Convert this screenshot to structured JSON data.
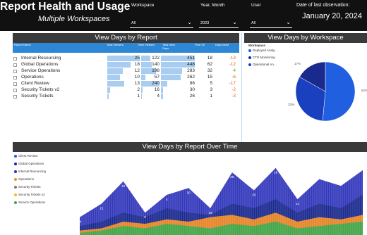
{
  "header": {
    "title": "Report Health and Usage",
    "subtitle": "Multiple Workspaces",
    "filters": [
      {
        "label": "Workspace",
        "value": "All"
      },
      {
        "label": "Year, Month",
        "value": "2023"
      },
      {
        "label": "User",
        "value": "All"
      }
    ],
    "date_label": "Date of last observation:",
    "date_value": "January 20, 2024"
  },
  "report_table": {
    "title": "View Days by Report",
    "columns": [
      "Report Name",
      "Total Viewers",
      "New Viewers",
      "Total View Days",
      "Prior 30",
      "Days MoM"
    ],
    "rows": [
      {
        "name": "Internal Resourcing",
        "total_viewers": "25",
        "new_viewers": "122",
        "total_view_days": "451",
        "prior_30": "18",
        "days_mom": "-13"
      },
      {
        "name": "Global Operations",
        "total_viewers": "18",
        "new_viewers": "140",
        "total_view_days": "448",
        "prior_30": "62",
        "days_mom": "-12"
      },
      {
        "name": "Service Operations",
        "total_viewers": "12",
        "new_viewers": "198",
        "total_view_days": "283",
        "prior_30": "32",
        "days_mom": "4"
      },
      {
        "name": "Operations",
        "total_viewers": "10",
        "new_viewers": "57",
        "total_view_days": "262",
        "prior_30": "15",
        "days_mom": "-6"
      },
      {
        "name": "Client Review",
        "total_viewers": "13",
        "new_viewers": "240",
        "total_view_days": "86",
        "prior_30": "5",
        "days_mom": "-17"
      },
      {
        "name": "Security Tickets v2",
        "total_viewers": "2",
        "new_viewers": "16",
        "total_view_days": "30",
        "prior_30": "3",
        "days_mom": "-2"
      },
      {
        "name": "Security Tickets",
        "total_viewers": "1",
        "new_viewers": "4",
        "total_view_days": "26",
        "prior_30": "1",
        "days_mom": "-3"
      }
    ]
  },
  "workspace_pie": {
    "title": "View Days by Workspace",
    "legend_title": "Workspace",
    "legend": [
      {
        "name": "Deployed Analy...",
        "color": "#1f5fe0"
      },
      {
        "name": "CTO Monitoring",
        "color": "#1a2a8c"
      },
      {
        "name": "Operational An...",
        "color": "#1a3fbf"
      }
    ],
    "slice_labels": [
      "17%",
      "52%",
      "32%"
    ]
  },
  "time_chart": {
    "title": "View Days by Report Over Time",
    "legend": [
      {
        "name": "Client Review",
        "color": "#1f5fe0"
      },
      {
        "name": "Global Operations",
        "color": "#1a2a8c"
      },
      {
        "name": "Internal Resourcing",
        "color": "#2a2fb8"
      },
      {
        "name": "Operations",
        "color": "#f08a24"
      },
      {
        "name": "Security Tickets",
        "color": "#7a7a7a"
      },
      {
        "name": "Security Tickets v2",
        "color": "#e8c020"
      },
      {
        "name": "Service Operations",
        "color": "#3aa64a"
      }
    ],
    "point_labels": [
      "24",
      "21",
      "10",
      "8",
      "4",
      "30",
      "29",
      "28",
      "25",
      "18",
      "14"
    ]
  },
  "chart_data": [
    {
      "type": "pie",
      "title": "View Days by Workspace",
      "categories": [
        "Deployed Analy...",
        "CTO Monitoring",
        "Operational An..."
      ],
      "values": [
        52,
        17,
        32
      ]
    },
    {
      "type": "area",
      "title": "View Days by Report Over Time",
      "series": [
        {
          "name": "Internal Resourcing",
          "values": [
            8,
            14,
            24,
            10,
            18,
            21,
            12,
            28,
            20,
            30,
            16,
            25,
            22,
            29
          ]
        },
        {
          "name": "Global Operations",
          "values": [
            4,
            6,
            10,
            8,
            12,
            10,
            9,
            14,
            12,
            16,
            10,
            14,
            12,
            18
          ]
        },
        {
          "name": "Operations",
          "values": [
            2,
            3,
            6,
            5,
            7,
            6,
            8,
            9,
            7,
            10,
            6,
            8,
            7,
            9
          ]
        },
        {
          "name": "Service Operations",
          "values": [
            1,
            2,
            4,
            3,
            5,
            4,
            3,
            5,
            4,
            6,
            3,
            4,
            5,
            6
          ]
        }
      ]
    }
  ]
}
